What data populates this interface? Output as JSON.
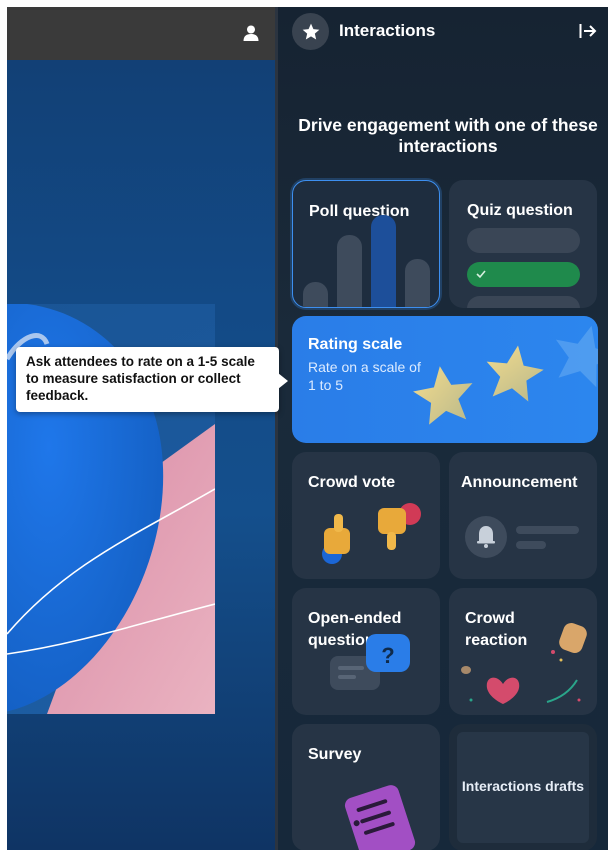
{
  "panel": {
    "title": "Interactions",
    "headline": "Drive engagement with one of these interactions"
  },
  "cards": {
    "poll": "Poll question",
    "quiz": "Quiz question",
    "rating": {
      "title": "Rating scale",
      "subtitle": "Rate on a scale of 1 to 5"
    },
    "crowd_vote": "Crowd vote",
    "announcement": "Announcement",
    "open_ended": "Open-ended question",
    "crowd_reaction": "Crowd reaction",
    "survey": "Survey",
    "drafts": "Interactions drafts"
  },
  "tooltip": {
    "text": "Ask attendees to rate on a 1-5 scale to measure satisfaction or collect feedback."
  },
  "colors": {
    "accent": "#2c86ee",
    "card": "#263445",
    "panel": "#1a2a3a",
    "quiz_correct": "#1f8a4c"
  },
  "icons": [
    "user-icon",
    "star-icon",
    "exit-panel-icon",
    "check-icon",
    "bell-icon",
    "question-icon"
  ]
}
